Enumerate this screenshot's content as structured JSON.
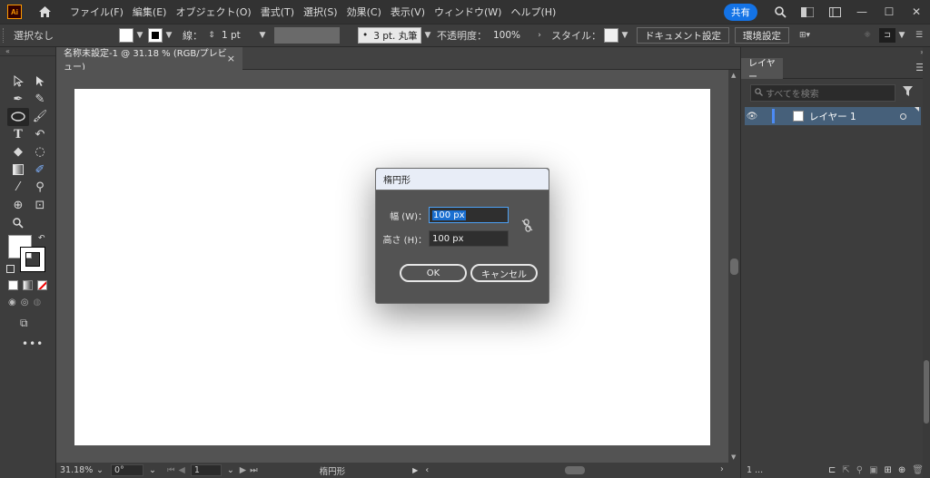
{
  "menubar": {
    "logo": "Ai",
    "menus": [
      "ファイル(F)",
      "編集(E)",
      "オブジェクト(O)",
      "書式(T)",
      "選択(S)",
      "効果(C)",
      "表示(V)",
      "ウィンドウ(W)",
      "ヘルプ(H)"
    ],
    "share_label": "共有"
  },
  "controlbar": {
    "selection": "選択なし",
    "stroke_label": "線：",
    "stroke_weight": "1 pt",
    "brush": "3 pt. 丸筆",
    "opacity_label": "不透明度：",
    "opacity_value": "100%",
    "style_label": "スタイル：",
    "document_setup": "ドキュメント設定",
    "preferences": "環境設定"
  },
  "document": {
    "tab_title": "名称未設定-1 @ 31.18 % (RGB/プレビュー)",
    "close": "×"
  },
  "statusbar": {
    "zoom": "31.18%",
    "rotation": "0°",
    "artboard_number": "1",
    "current_tool": "楕円形"
  },
  "layers_panel": {
    "tab_label": "レイヤー",
    "search_placeholder": "すべてを検索",
    "layers": [
      {
        "name": "レイヤー 1"
      }
    ],
    "count_label": "1 ..."
  },
  "dialog": {
    "title": "楕円形",
    "width_label": "幅 (W)：",
    "width_value": "100 px",
    "height_label": "高さ (H)：",
    "height_value": "100 px",
    "ok_label": "OK",
    "cancel_label": "キャンセル"
  },
  "colors": {
    "accent": "#1473e6",
    "layer_highlight": "#46607a"
  }
}
